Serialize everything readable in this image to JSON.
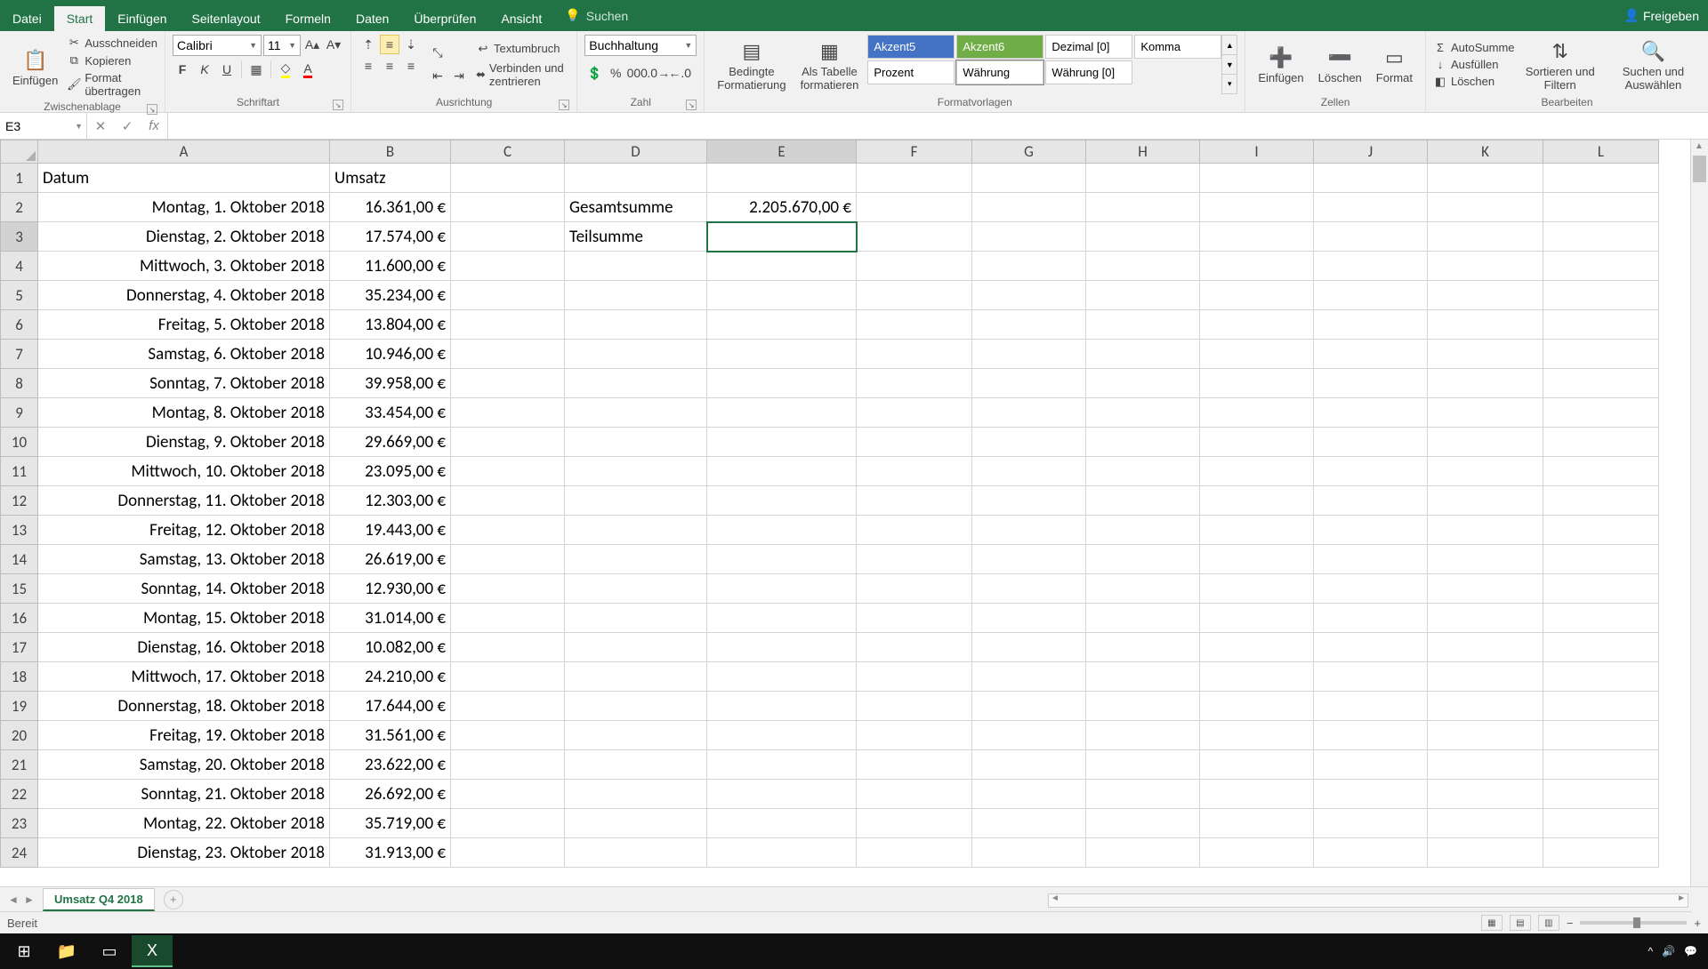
{
  "titlebar": {
    "menu": {
      "datei": "Datei",
      "start": "Start",
      "einfuegen": "Einfügen",
      "seitenlayout": "Seitenlayout",
      "formeln": "Formeln",
      "daten": "Daten",
      "ueberpruefen": "Überprüfen",
      "ansicht": "Ansicht"
    },
    "search_placeholder": "Suchen",
    "share": "Freigeben"
  },
  "ribbon": {
    "clipboard": {
      "paste": "Einfügen",
      "cut": "Ausschneiden",
      "copy": "Kopieren",
      "format_painter": "Format übertragen",
      "label": "Zwischenablage"
    },
    "font": {
      "name": "Calibri",
      "size": "11",
      "label": "Schriftart"
    },
    "alignment": {
      "wrap": "Textumbruch",
      "merge": "Verbinden und zentrieren",
      "label": "Ausrichtung"
    },
    "number": {
      "format": "Buchhaltung",
      "label": "Zahl"
    },
    "styles": {
      "conditional": "Bedingte Formatierung",
      "as_table": "Als Tabelle formatieren",
      "items": [
        "Akzent5",
        "Akzent6",
        "Dezimal [0]",
        "Komma",
        "Prozent",
        "Währung",
        "Währung [0]"
      ],
      "label": "Formatvorlagen"
    },
    "cells": {
      "insert": "Einfügen",
      "delete": "Löschen",
      "format": "Format",
      "label": "Zellen"
    },
    "editing": {
      "autosum": "AutoSumme",
      "fill": "Ausfüllen",
      "clear": "Löschen",
      "sort": "Sortieren und Filtern",
      "find": "Suchen und Auswählen",
      "label": "Bearbeiten"
    }
  },
  "namebox": "E3",
  "formula": "",
  "columns": [
    "A",
    "B",
    "C",
    "D",
    "E",
    "F",
    "G",
    "H",
    "I",
    "J",
    "K",
    "L"
  ],
  "headers": {
    "A": "Datum",
    "B": "Umsatz"
  },
  "side": {
    "gesamt_label": "Gesamtsumme",
    "gesamt_value": "2.205.670,00 €",
    "teil_label": "Teilsumme"
  },
  "rows": [
    {
      "n": 1
    },
    {
      "n": 2,
      "a": "Montag, 1. Oktober 2018",
      "b": "16.361,00 €"
    },
    {
      "n": 3,
      "a": "Dienstag, 2. Oktober 2018",
      "b": "17.574,00 €"
    },
    {
      "n": 4,
      "a": "Mittwoch, 3. Oktober 2018",
      "b": "11.600,00 €"
    },
    {
      "n": 5,
      "a": "Donnerstag, 4. Oktober 2018",
      "b": "35.234,00 €"
    },
    {
      "n": 6,
      "a": "Freitag, 5. Oktober 2018",
      "b": "13.804,00 €"
    },
    {
      "n": 7,
      "a": "Samstag, 6. Oktober 2018",
      "b": "10.946,00 €"
    },
    {
      "n": 8,
      "a": "Sonntag, 7. Oktober 2018",
      "b": "39.958,00 €"
    },
    {
      "n": 9,
      "a": "Montag, 8. Oktober 2018",
      "b": "33.454,00 €"
    },
    {
      "n": 10,
      "a": "Dienstag, 9. Oktober 2018",
      "b": "29.669,00 €"
    },
    {
      "n": 11,
      "a": "Mittwoch, 10. Oktober 2018",
      "b": "23.095,00 €"
    },
    {
      "n": 12,
      "a": "Donnerstag, 11. Oktober 2018",
      "b": "12.303,00 €"
    },
    {
      "n": 13,
      "a": "Freitag, 12. Oktober 2018",
      "b": "19.443,00 €"
    },
    {
      "n": 14,
      "a": "Samstag, 13. Oktober 2018",
      "b": "26.619,00 €"
    },
    {
      "n": 15,
      "a": "Sonntag, 14. Oktober 2018",
      "b": "12.930,00 €"
    },
    {
      "n": 16,
      "a": "Montag, 15. Oktober 2018",
      "b": "31.014,00 €"
    },
    {
      "n": 17,
      "a": "Dienstag, 16. Oktober 2018",
      "b": "10.082,00 €"
    },
    {
      "n": 18,
      "a": "Mittwoch, 17. Oktober 2018",
      "b": "24.210,00 €"
    },
    {
      "n": 19,
      "a": "Donnerstag, 18. Oktober 2018",
      "b": "17.644,00 €"
    },
    {
      "n": 20,
      "a": "Freitag, 19. Oktober 2018",
      "b": "31.561,00 €"
    },
    {
      "n": 21,
      "a": "Samstag, 20. Oktober 2018",
      "b": "23.622,00 €"
    },
    {
      "n": 22,
      "a": "Sonntag, 21. Oktober 2018",
      "b": "26.692,00 €"
    },
    {
      "n": 23,
      "a": "Montag, 22. Oktober 2018",
      "b": "35.719,00 €"
    },
    {
      "n": 24,
      "a": "Dienstag, 23. Oktober 2018",
      "b": "31.913,00 €"
    }
  ],
  "sheet_tab": "Umsatz Q4 2018",
  "status": "Bereit",
  "selected_col": "E",
  "selected_row": 3
}
